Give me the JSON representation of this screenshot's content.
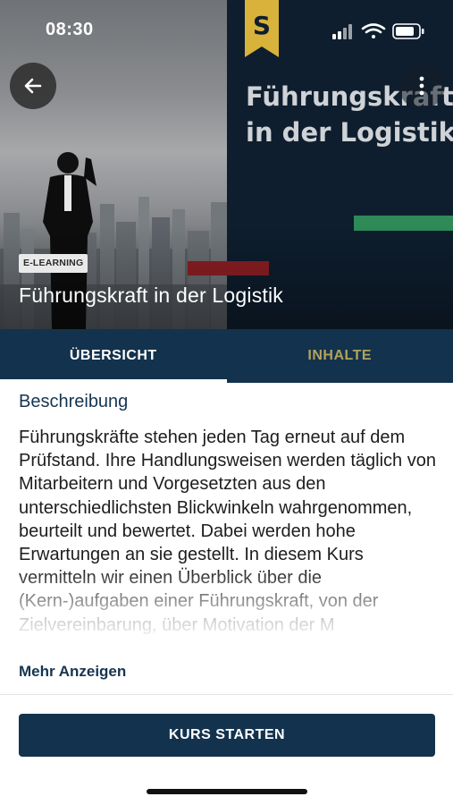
{
  "status_bar": {
    "time": "08:30"
  },
  "hero": {
    "brand_letter": "S",
    "headline_line1": "Führungskraft",
    "headline_line2": "in der Logistik",
    "badge": "E-LEARNING",
    "title": "Führungskraft in der Logistik",
    "colors": {
      "dark": "#0e1e2e",
      "green_stripe": "#2e8b57",
      "red_stripe": "#8f1f24",
      "brand_yellow": "#d8b23a"
    }
  },
  "tabs": [
    {
      "label": "ÜBERSICHT",
      "active": true
    },
    {
      "label": "INHALTE",
      "active": false
    }
  ],
  "description": {
    "heading": "Beschreibung",
    "text": "Führungskräfte stehen jeden Tag erneut auf dem Prüfstand. Ihre Handlungsweisen werden täglich von Mitarbeitern und Vorgesetzten aus den unterschiedlichsten Blickwinkeln wahrgenommen, beurteilt und bewertet. Dabei werden hohe Erwartungen an sie gestellt. In diesem Kurs vermitteln wir einen Überblick über die (Kern-)aufgaben einer Führungskraft, von der Zielvereinbarung, über Motivation der M",
    "more_label": "Mehr Anzeigen"
  },
  "actions": {
    "start_label": "KURS STARTEN"
  },
  "colors": {
    "primary": "#13324d",
    "tab_inactive": "#b3a35a"
  },
  "icons": [
    "arrow-left-icon",
    "more-vertical-icon",
    "signal-icon",
    "wifi-icon",
    "battery-icon"
  ]
}
